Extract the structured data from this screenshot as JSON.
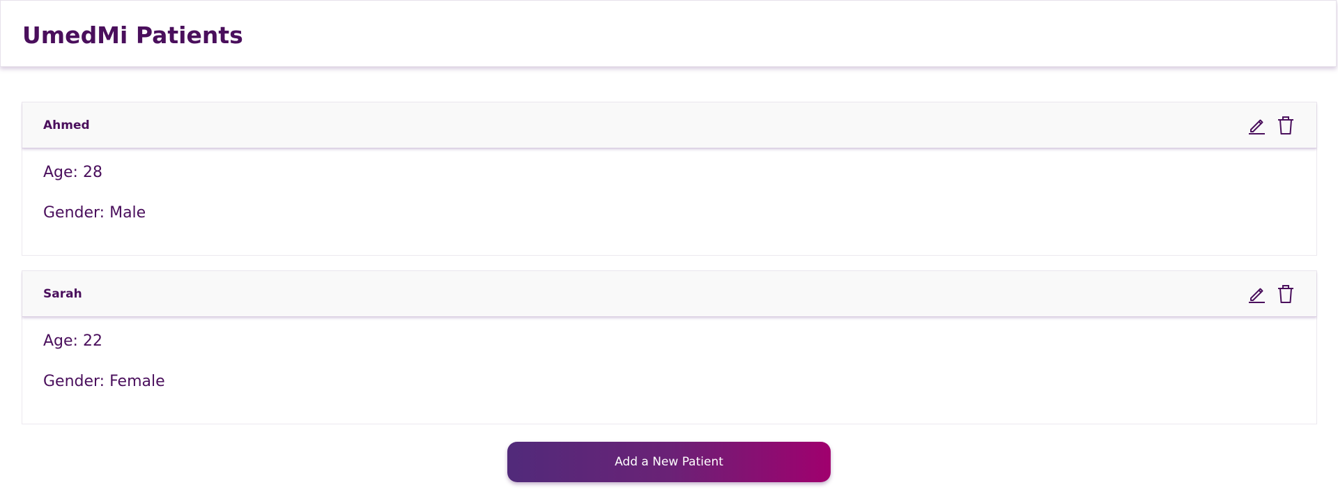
{
  "app": {
    "title": "UmedMi Patients"
  },
  "patients": [
    {
      "name": "Ahmed",
      "age_text": "Age: 28",
      "gender_text": "Gender: Male"
    },
    {
      "name": "Sarah",
      "age_text": "Age: 22",
      "gender_text": "Gender: Female"
    }
  ],
  "icons": {
    "edit": "edit-icon",
    "delete": "trash-icon"
  },
  "actions": {
    "add_patient_label": "Add a New Patient"
  },
  "colors": {
    "primary_text": "#4a0f5c",
    "button_gradient_start": "#512a7a",
    "button_gradient_end": "#a0006e"
  }
}
